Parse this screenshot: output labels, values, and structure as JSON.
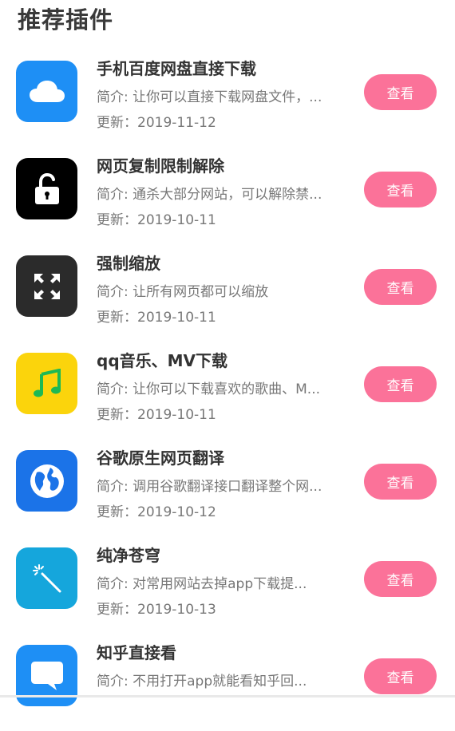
{
  "page_title": "推荐插件",
  "plugins": [
    {
      "name": "手机百度网盘直接下载",
      "desc": "简介: 让你可以直接下载网盘文件，...",
      "date": "更新：2019-11-12",
      "button": "查看",
      "icon": "cloud-icon",
      "icon_color": "#1e8ff5"
    },
    {
      "name": "网页复制限制解除",
      "desc": "简介: 通杀大部分网站，可以解除禁...",
      "date": "更新：2019-10-11",
      "button": "查看",
      "icon": "unlock-icon",
      "icon_color": "#000000"
    },
    {
      "name": "强制缩放",
      "desc": "简介: 让所有网页都可以缩放",
      "date": "更新：2019-10-11",
      "button": "查看",
      "icon": "expand-arrows-icon",
      "icon_color": "#2b2b2b"
    },
    {
      "name": "qq音乐、MV下载",
      "desc": "简介: 让你可以下载喜欢的歌曲、M...",
      "date": "更新：2019-10-11",
      "button": "查看",
      "icon": "music-note-icon",
      "icon_color": "#fbd40c"
    },
    {
      "name": "谷歌原生网页翻译",
      "desc": "简介: 调用谷歌翻译接口翻译整个网...",
      "date": "更新：2019-10-12",
      "button": "查看",
      "icon": "globe-icon",
      "icon_color": "#1b73e8"
    },
    {
      "name": "纯净苍穹",
      "desc": "简介: 对常用网站去掉app下载提...",
      "date": "更新：2019-10-13",
      "button": "查看",
      "icon": "magic-wand-icon",
      "icon_color": "#15a6dc"
    },
    {
      "name": "知乎直接看",
      "desc": "简介: 不用打开app就能看知乎回...",
      "date": "",
      "button": "查看",
      "icon": "chat-bubble-icon",
      "icon_color": "#1e8ff5"
    }
  ],
  "colors": {
    "accent": "#fb7299"
  }
}
